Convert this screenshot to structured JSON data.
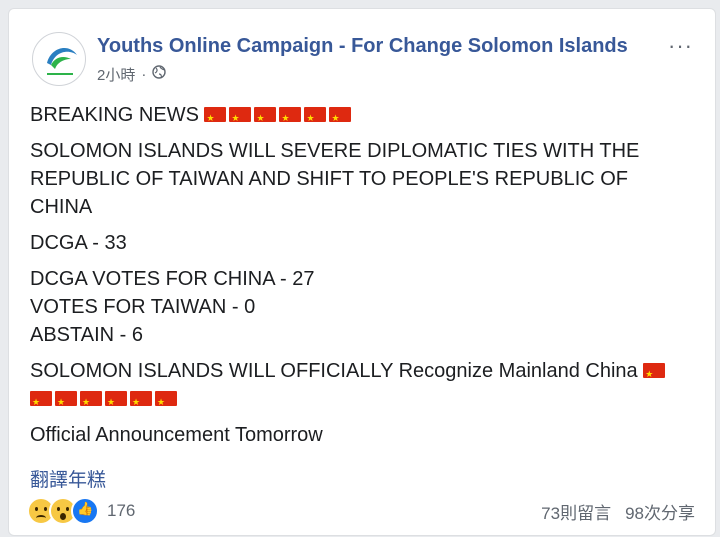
{
  "post": {
    "page_name": "Youths Online Campaign - For Change Solomon Islands",
    "time": "2小時",
    "separator": "·",
    "icons": {
      "privacy": "globe-icon",
      "more": "more-icon"
    },
    "more": "···",
    "lines": {
      "breaking": "BREAKING NEWS",
      "severe": "SOLOMON ISLANDS WILL SEVERE DIPLOMATIC TIES WITH THE REPUBLIC OF TAIWAN AND SHIFT TO PEOPLE'S REPUBLIC OF CHINA",
      "dcga": "DCGA - 33",
      "votes_china": "DCGA VOTES FOR CHINA - 27",
      "votes_taiwan": "VOTES FOR TAIWAN - 0",
      "abstain": "ABSTAIN - 6",
      "recognize": "SOLOMON ISLANDS WILL OFFICIALLY Recognize Mainland China",
      "announcement": "Official Announcement Tomorrow"
    },
    "translate_link": "翻譯年糕",
    "reactions": {
      "types": [
        "sad",
        "wow",
        "like"
      ],
      "count": "176"
    },
    "comments": "73則留言",
    "shares": "98次分享",
    "colors": {
      "link": "#385898",
      "meta": "#606770",
      "flag_red": "#de2910",
      "flag_star": "#ffde00"
    }
  }
}
